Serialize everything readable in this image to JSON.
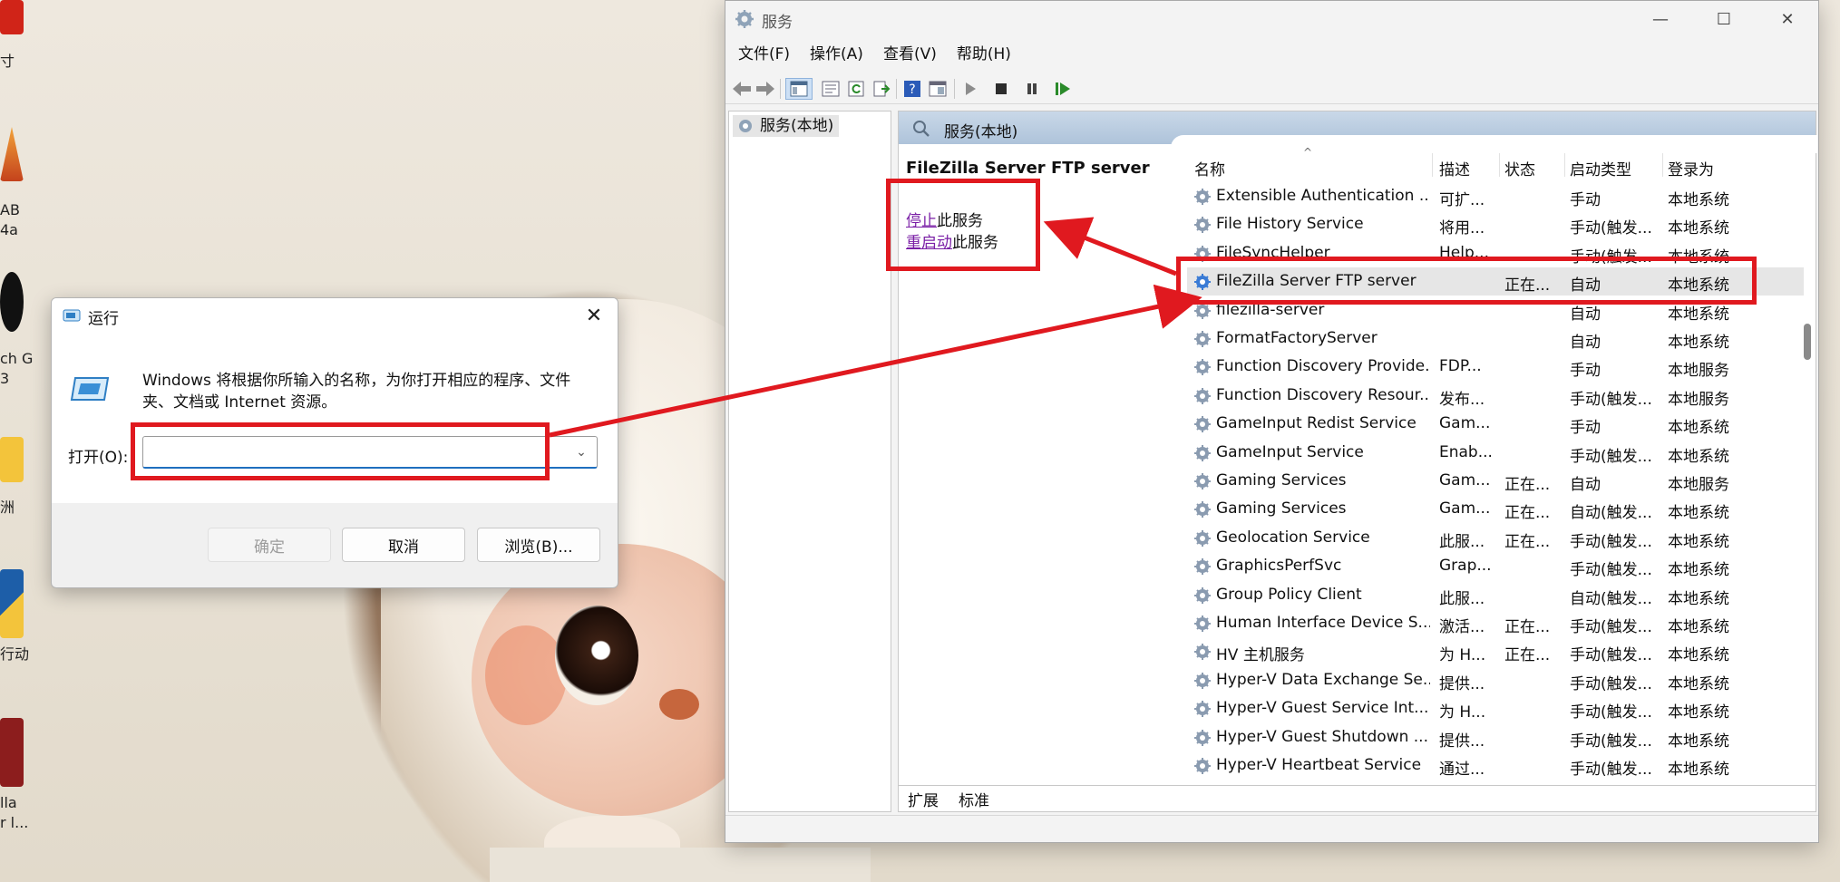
{
  "desktop": {
    "labels": [
      "寸",
      "AB",
      "4a",
      "ch G",
      "3",
      "洲",
      "行动",
      "lla",
      "r l..."
    ]
  },
  "services_window": {
    "title": "服务",
    "window_buttons": {
      "minimize": "—",
      "maximize": "☐",
      "close": "✕"
    },
    "menu": [
      "文件(F)",
      "操作(A)",
      "查看(V)",
      "帮助(H)"
    ],
    "tree": {
      "root": "服务(本地)"
    },
    "panel_header": "服务(本地)",
    "selected_service": {
      "name": "FileZilla Server FTP server",
      "actions": [
        {
          "link": "停止",
          "suffix": "此服务"
        },
        {
          "link": "重启动",
          "suffix": "此服务"
        }
      ]
    },
    "columns": [
      "名称",
      "描述",
      "状态",
      "启动类型",
      "登录为"
    ],
    "rows": [
      {
        "name": "Extensible Authentication ...",
        "desc": "可扩...",
        "status": "",
        "startup": "手动",
        "logon": "本地系统"
      },
      {
        "name": "File History Service",
        "desc": "将用...",
        "status": "",
        "startup": "手动(触发...",
        "logon": "本地系统"
      },
      {
        "name": "FileSyncHelper",
        "desc": "Help...",
        "status": "",
        "startup": "手动(触发...",
        "logon": "本地系统"
      },
      {
        "name": "FileZilla Server FTP server",
        "desc": "",
        "status": "正在...",
        "startup": "自动",
        "logon": "本地系统"
      },
      {
        "name": "filezilla-server",
        "desc": "",
        "status": "",
        "startup": "自动",
        "logon": "本地系统"
      },
      {
        "name": "FormatFactoryServer",
        "desc": "",
        "status": "",
        "startup": "自动",
        "logon": "本地系统"
      },
      {
        "name": "Function Discovery Provide...",
        "desc": "FDP...",
        "status": "",
        "startup": "手动",
        "logon": "本地服务"
      },
      {
        "name": "Function Discovery Resour...",
        "desc": "发布...",
        "status": "",
        "startup": "手动(触发...",
        "logon": "本地服务"
      },
      {
        "name": "GameInput Redist Service",
        "desc": "Gam...",
        "status": "",
        "startup": "手动",
        "logon": "本地系统"
      },
      {
        "name": "GameInput Service",
        "desc": "Enab...",
        "status": "",
        "startup": "手动(触发...",
        "logon": "本地系统"
      },
      {
        "name": "Gaming Services",
        "desc": "Gam...",
        "status": "正在...",
        "startup": "自动",
        "logon": "本地服务"
      },
      {
        "name": "Gaming Services",
        "desc": "Gam...",
        "status": "正在...",
        "startup": "自动(触发...",
        "logon": "本地系统"
      },
      {
        "name": "Geolocation Service",
        "desc": "此服...",
        "status": "正在...",
        "startup": "手动(触发...",
        "logon": "本地系统"
      },
      {
        "name": "GraphicsPerfSvc",
        "desc": "Grap...",
        "status": "",
        "startup": "手动(触发...",
        "logon": "本地系统"
      },
      {
        "name": "Group Policy Client",
        "desc": "此服...",
        "status": "",
        "startup": "自动(触发...",
        "logon": "本地系统"
      },
      {
        "name": "Human Interface Device S...",
        "desc": "激活...",
        "status": "正在...",
        "startup": "手动(触发...",
        "logon": "本地系统"
      },
      {
        "name": "HV 主机服务",
        "desc": "为 H...",
        "status": "正在...",
        "startup": "手动(触发...",
        "logon": "本地系统"
      },
      {
        "name": "Hyper-V Data Exchange Se...",
        "desc": "提供...",
        "status": "",
        "startup": "手动(触发...",
        "logon": "本地系统"
      },
      {
        "name": "Hyper-V Guest Service Int...",
        "desc": "为 H...",
        "status": "",
        "startup": "手动(触发...",
        "logon": "本地系统"
      },
      {
        "name": "Hyper-V Guest Shutdown ...",
        "desc": "提供...",
        "status": "",
        "startup": "手动(触发...",
        "logon": "本地系统"
      },
      {
        "name": "Hyper-V Heartbeat Service",
        "desc": "通过...",
        "status": "",
        "startup": "手动(触发...",
        "logon": "本地系统"
      }
    ],
    "tabs": [
      "扩展",
      "标准"
    ]
  },
  "run_dialog": {
    "title": "运行",
    "close": "✕",
    "description_line1": "Windows 将根据你所输入的名称，为你打开相应的程序、文件",
    "description_line2": "夹、文档或 Internet 资源。",
    "open_label": "打开(O):",
    "input_value": "",
    "buttons": {
      "ok": "确定",
      "cancel": "取消",
      "browse": "浏览(B)..."
    }
  },
  "colors": {
    "annotation_red": "#e0191f",
    "panel_header": "#aec3da",
    "link_purple": "#7a1fa6",
    "input_focus": "#1f6fbf"
  }
}
